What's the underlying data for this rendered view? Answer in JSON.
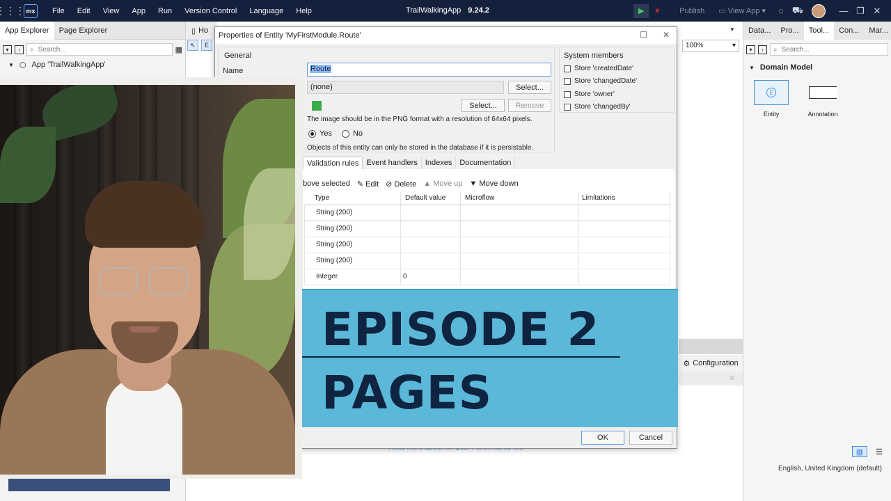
{
  "topbar": {
    "menu": [
      "File",
      "Edit",
      "View",
      "App",
      "Run",
      "Version Control",
      "Language",
      "Help"
    ],
    "app_name": "TrailWalkingApp",
    "version": "9.24.2",
    "publish": "Publish",
    "view_app": "View App"
  },
  "left": {
    "tab_app_explorer": "App Explorer",
    "tab_page_explorer": "Page Explorer",
    "search_placeholder": "Search...",
    "tree_app": "App 'TrailWalkingApp'"
  },
  "middle": {
    "tab_label": "Ho",
    "zoom": "100%",
    "configuration": "Configuration",
    "perf_link": "Read more about Mx Best Performance tool"
  },
  "right": {
    "tabs": [
      "Data...",
      "Pro...",
      "Tool...",
      "Con...",
      "Mar..."
    ],
    "search_placeholder": "Search...",
    "section": "Domain Model",
    "entity": "Entity",
    "annotation": "Annotation",
    "language": "English, United Kingdom (default)"
  },
  "dialog": {
    "title": "Properties of Entity 'MyFirstModule.Route'",
    "general": "General",
    "name_label": "Name",
    "name_value": "Route",
    "generalization": "(none)",
    "select": "Select...",
    "remove": "Remove",
    "image_hint": "The image should be in the PNG format with a resolution of 64x64 pixels.",
    "yes": "Yes",
    "no": "No",
    "persist_note": "Objects of this entity can only be stored in the database if it is persistable.",
    "system_members": "System members",
    "sys": [
      "Store 'createdDate'",
      "Store 'changedDate'",
      "Store 'owner'",
      "Store 'changedBy'"
    ],
    "subtabs": [
      "Validation rules",
      "Event handlers",
      "Indexes",
      "Documentation"
    ],
    "toolbar": {
      "above_selected": "bove selected",
      "edit": "Edit",
      "delete": "Delete",
      "move_up": "Move up",
      "move_down": "Move down"
    },
    "columns": [
      "Type",
      "Default value",
      "Microflow",
      "Limitations"
    ],
    "rows": [
      {
        "type": "String (200)",
        "default": ""
      },
      {
        "type": "String (200)",
        "default": ""
      },
      {
        "type": "String (200)",
        "default": ""
      },
      {
        "type": "String (200)",
        "default": ""
      },
      {
        "type": "Integer",
        "default": "0"
      }
    ],
    "ok": "OK",
    "cancel": "Cancel"
  },
  "banner": {
    "line1": "EPISODE 2",
    "line2": "PAGES"
  },
  "colors": {
    "topbar": "#14213d",
    "banner": "#5bb8d8",
    "banner_text": "#0f2440",
    "accent": "#4a90d9"
  }
}
